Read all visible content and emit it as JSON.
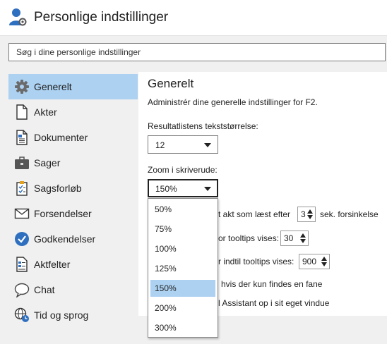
{
  "title": "Personlige indstillinger",
  "search": {
    "placeholder": "Søg i dine personlige indstillinger"
  },
  "sidebar": {
    "items": [
      {
        "label": "Generelt",
        "icon": "gear-icon"
      },
      {
        "label": "Akter",
        "icon": "document-icon"
      },
      {
        "label": "Dokumenter",
        "icon": "document-lines-icon"
      },
      {
        "label": "Sager",
        "icon": "briefcase-icon"
      },
      {
        "label": "Sagsforløb",
        "icon": "clipboard-checklist-icon"
      },
      {
        "label": "Forsendelser",
        "icon": "envelope-icon"
      },
      {
        "label": "Godkendelser",
        "icon": "checkmark-circle-icon"
      },
      {
        "label": "Aktfelter",
        "icon": "form-fields-icon"
      },
      {
        "label": "Chat",
        "icon": "speech-bubble-icon"
      },
      {
        "label": "Tid og sprog",
        "icon": "globe-clock-icon"
      }
    ],
    "selected_index": 0
  },
  "main": {
    "heading": "Generelt",
    "description": "Administrér dine generelle indstillinger for F2.",
    "font_size_label": "Resultatlistens tekststørrelse:",
    "font_size_value": "12",
    "zoom_label": "Zoom i skriverude:",
    "zoom_value": "150%",
    "mark_read_prefix": "t akt som læst efter",
    "mark_read_value": "3",
    "mark_read_suffix": "sek. forsinkelse",
    "tooltip_show_prefix": "or tooltips vises:",
    "tooltip_show_value": "30",
    "tooltip_until_prefix": "r indtil tooltips vises:",
    "tooltip_until_value": "900",
    "single_tab_text": "hvis der kun findes en fane",
    "assistant_text": "l Assistant op i sit eget vindue"
  },
  "zoom_dropdown": {
    "options": [
      "50%",
      "75%",
      "100%",
      "125%",
      "150%",
      "200%",
      "300%"
    ],
    "selected": "150%"
  },
  "colors": {
    "selection": "#acd1f1",
    "sidebar_bg": "#f0f0f0",
    "accent_blue": "#2f6fbf"
  }
}
